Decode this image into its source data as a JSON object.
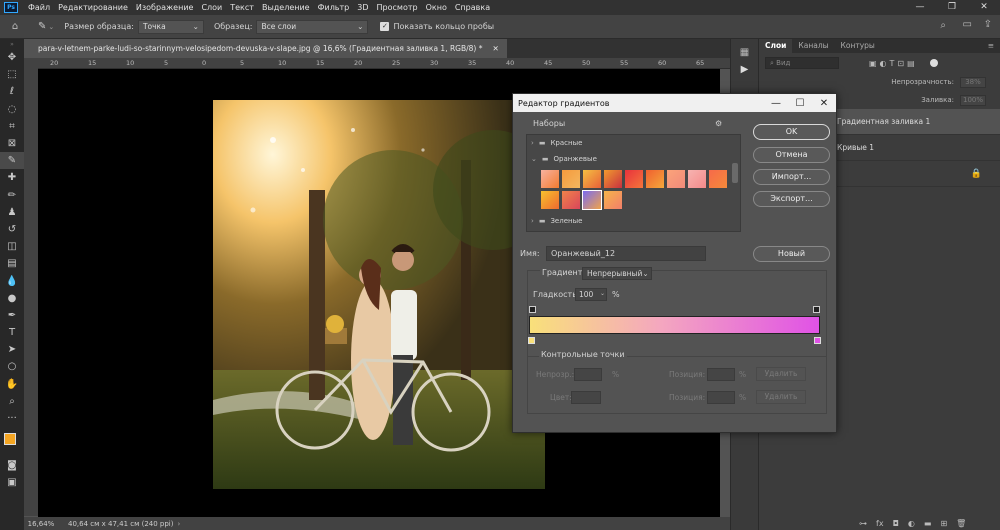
{
  "menubar": {
    "logo": "Ps",
    "items": [
      "Файл",
      "Редактирование",
      "Изображение",
      "Слои",
      "Текст",
      "Выделение",
      "Фильтр",
      "3D",
      "Просмотр",
      "Окно",
      "Справка"
    ],
    "window_controls": [
      "—",
      "❐",
      "✕"
    ]
  },
  "options": {
    "sample_size_label": "Размер образца:",
    "sample_size_value": "Точка",
    "sample_label": "Образец:",
    "sample_value": "Все слои",
    "show_ring_label": "Показать кольцо пробы"
  },
  "document": {
    "tab_title": "para-v-letnem-parke-ludi-so-starinnym-velosipedom-devuska-v-slape.jpg @ 16,6% (Градиентная заливка 1, RGB/8) *",
    "tab_close": "✕",
    "ruler_ticks": [
      "20",
      "15",
      "10",
      "5",
      "0",
      "5",
      "10",
      "15",
      "20",
      "25",
      "30",
      "35",
      "40",
      "45",
      "50",
      "55",
      "60",
      "65"
    ]
  },
  "status": {
    "zoom": "16,64%",
    "info": "40,64 см x 47,41 см (240 ppi)"
  },
  "panels": {
    "tabs": [
      "Слои",
      "Каналы",
      "Контуры"
    ],
    "search_placeholder": "Вид",
    "opacity_label": "Непрозрачность:",
    "opacity_value": "38%",
    "fill_label": "Заливка:",
    "fill_value": "100%",
    "layers": [
      "Градиентная заливка 1",
      "Кривые 1"
    ]
  },
  "dialog": {
    "title": "Редактор градиентов",
    "presets_label": "Наборы",
    "folders": [
      "Красные",
      "Оранжевые",
      "Зеленые"
    ],
    "buttons": {
      "ok": "OK",
      "cancel": "Отмена",
      "import": "Импорт...",
      "export": "Экспорт...",
      "new": "Новый"
    },
    "name_label": "Имя:",
    "name_value": "Оранжевый_12",
    "gradient_type_label": "Градиент:",
    "gradient_type_value": "Непрерывный",
    "smoothness_label": "Гладкость:",
    "smoothness_value": "100",
    "smoothness_unit": "%",
    "stops_label": "Контрольные точки",
    "opacity_label": "Непрозр.:",
    "location_label": "Позиция:",
    "percent": "%",
    "delete_label": "Удалить",
    "color_label": "Цвет:",
    "gradient_start_color": "#f9e07a",
    "gradient_end_color": "#e052e6"
  },
  "swatches": [
    [
      "#f7b2a0",
      "#f47b2f"
    ],
    [
      "#f59a3d",
      "#f3b75f"
    ],
    [
      "#f4c042",
      "#e86038"
    ],
    [
      "#f09a2e",
      "#c9303f"
    ],
    [
      "#e8323c",
      "#f5763b"
    ],
    [
      "#f06030",
      "#f5a83a"
    ],
    [
      "#fba37a",
      "#f08a7a"
    ],
    [
      "#f7b3b0",
      "#f48a8a"
    ],
    [
      "#f66a4a",
      "#f58a3a"
    ],
    [
      "#f5c12e",
      "#f06a2f"
    ],
    [
      "#f0834a",
      "#d9465a"
    ],
    [
      "#7b6cf0",
      "#f0a34a"
    ],
    [
      "#f5b44a",
      "#f27f6a"
    ]
  ]
}
